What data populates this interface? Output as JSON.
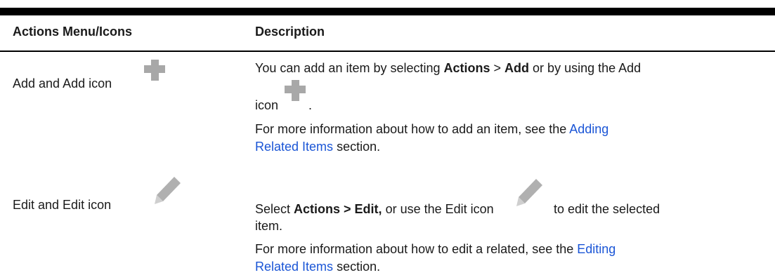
{
  "table": {
    "headers": [
      "Actions Menu/Icons",
      "Description"
    ],
    "rows": [
      {
        "action": "Add and Add icon",
        "icon": "plus-icon",
        "desc1_pre": "You can add an item by selecting ",
        "desc1_b1": "Actions",
        "desc1_mid": " > ",
        "desc1_b2": "Add",
        "desc1_post": " or by using the Add",
        "desc1_line2": "icon",
        "desc1_end": ".",
        "desc2_pre": "For more information about how to add an item, see the ",
        "desc2_link1": "Adding",
        "desc2_link2": "Related Items",
        "desc2_post": " section."
      },
      {
        "action": "Edit and Edit icon",
        "icon": "pencil-icon",
        "desc1_pre": "Select ",
        "desc1_b": "Actions > Edit,",
        "desc1_mid": " or use the Edit icon",
        "desc1_post": "to edit the selected",
        "desc1_line2": "item.",
        "desc2_pre": "For more information about how to edit a related, see the ",
        "desc2_link1": "Editing",
        "desc2_link2": "Related Items",
        "desc2_post": " section."
      }
    ]
  },
  "colors": {
    "link": "#1a55d6",
    "icon": "#a8a8a8",
    "rule": "#000000"
  }
}
